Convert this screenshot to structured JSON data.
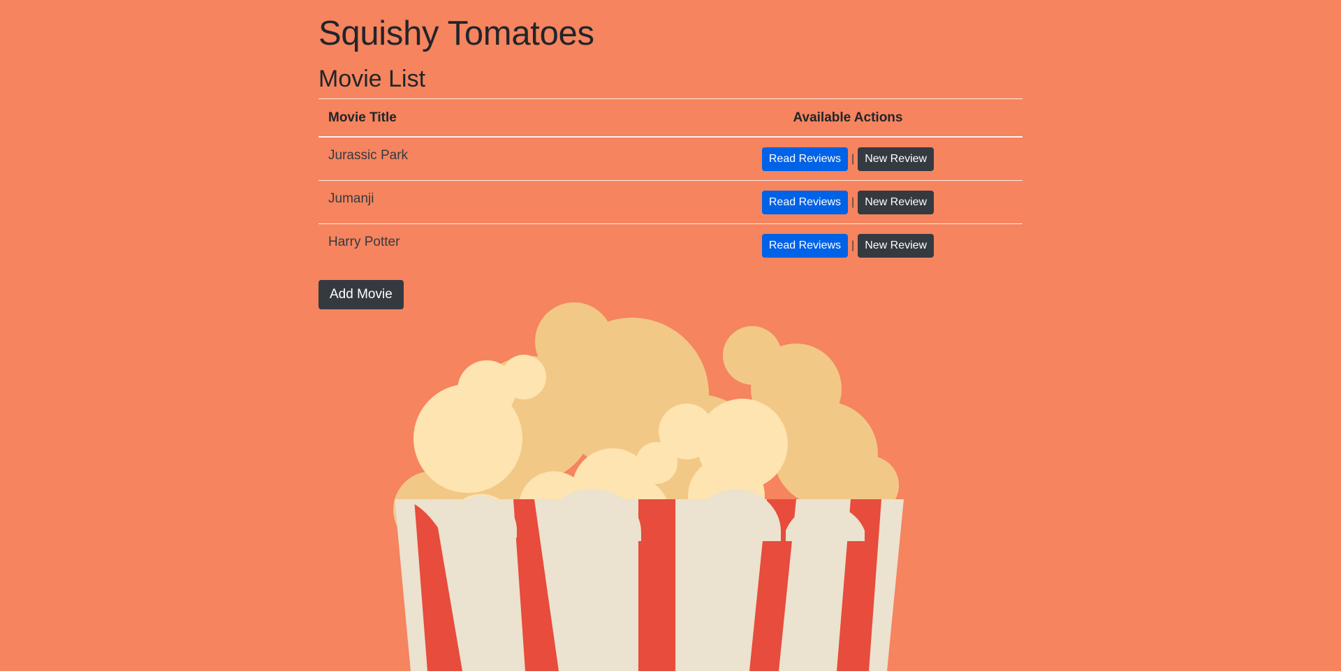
{
  "header": {
    "app_title": "Squishy Tomatoes",
    "section_title": "Movie List"
  },
  "table": {
    "columns": [
      "Movie Title",
      "Available Actions"
    ],
    "rows": [
      {
        "title": "Jurassic Park",
        "read_label": "Read Reviews",
        "separator": "|",
        "new_label": "New Review"
      },
      {
        "title": "Jumanji",
        "read_label": "Read Reviews",
        "separator": "|",
        "new_label": "New Review"
      },
      {
        "title": "Harry Potter",
        "read_label": "Read Reviews",
        "separator": "|",
        "new_label": "New Review"
      }
    ]
  },
  "add_movie_label": "Add Movie",
  "illustration": {
    "icon": "popcorn-icon"
  },
  "colors": {
    "background": "#f5845f",
    "primary": "#0062e6",
    "dark": "#343a40",
    "popcorn_light": "#fde4b0",
    "popcorn_dark": "#f2c886",
    "box_stripe_red": "#e74c3c",
    "box_stripe_cream": "#ebe2cf"
  }
}
